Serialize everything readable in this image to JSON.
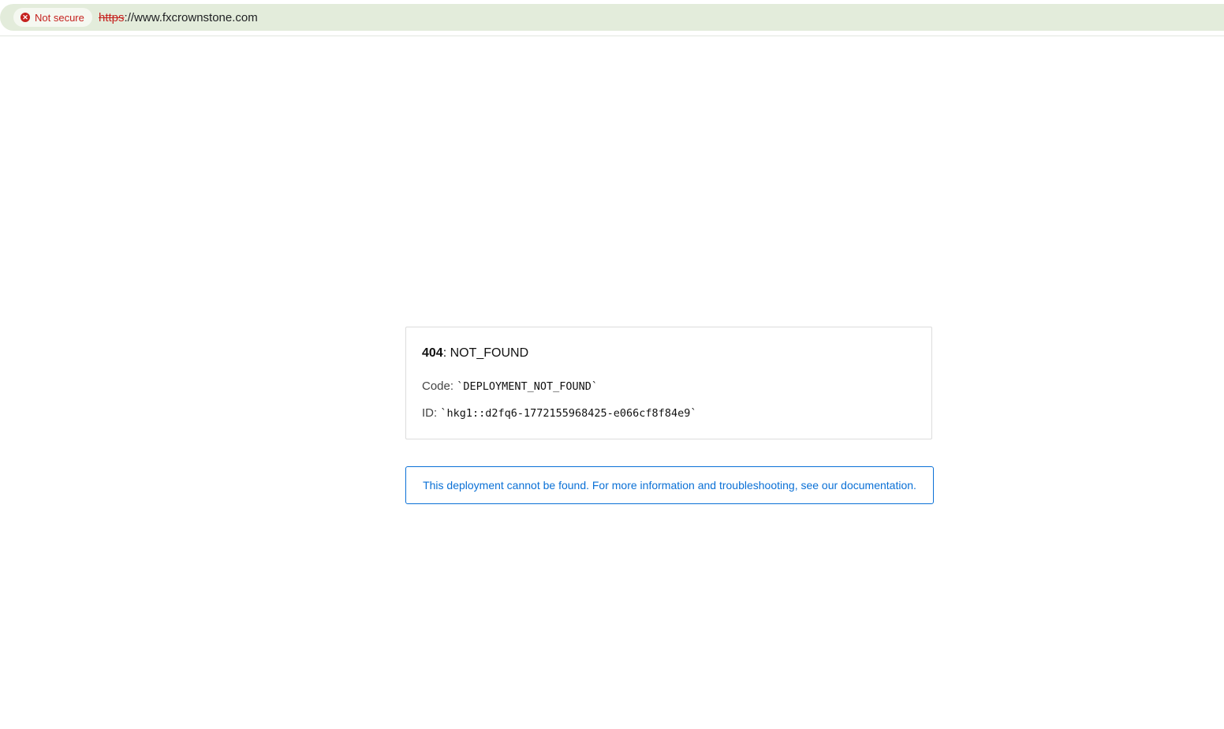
{
  "browser": {
    "security_label": "Not secure",
    "url_scheme": "https",
    "url_rest": "://www.fxcrownstone.com"
  },
  "error": {
    "status_code": "404",
    "status_text": ": NOT_FOUND",
    "code_label": "Code:",
    "code_value": "`DEPLOYMENT_NOT_FOUND`",
    "id_label": "ID:",
    "id_value": "`hkg1::d2fq6-1772155968425-e066cf8f84e9`"
  },
  "info": {
    "message": "This deployment cannot be found. For more information and troubleshooting, see our",
    "link_text": "documentation."
  }
}
